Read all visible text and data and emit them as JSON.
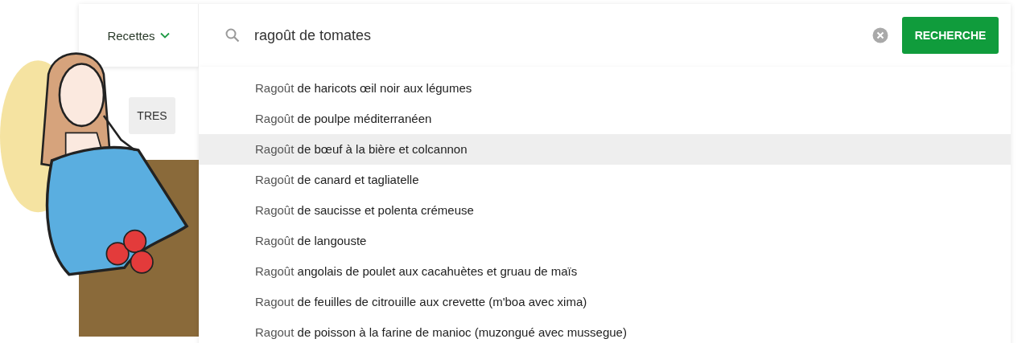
{
  "category_menu": {
    "label": "Recettes"
  },
  "search": {
    "value": "ragoût de tomates",
    "button": "RECHERCHE"
  },
  "filter_button": {
    "label": "TRES"
  },
  "suggestions": [
    {
      "match": "Ragoût",
      "rest": " de haricots œil noir aux légumes",
      "selected": false
    },
    {
      "match": "Ragoût",
      "rest": " de poulpe méditerranéen",
      "selected": false
    },
    {
      "match": "Ragoût",
      "rest": " de bœuf à la bière et colcannon",
      "selected": true
    },
    {
      "match": "Ragoût",
      "rest": " de canard et tagliatelle",
      "selected": false
    },
    {
      "match": "Ragoût",
      "rest": " de saucisse et polenta crémeuse",
      "selected": false
    },
    {
      "match": "Ragoût",
      "rest": " de langouste",
      "selected": false
    },
    {
      "match": "Ragoût",
      "rest": " angolais de poulet aux cacahuètes et gruau de maïs",
      "selected": false
    },
    {
      "match": "Ragout",
      "rest": " de feuilles de citrouille aux crevette (m'boa avec xima)",
      "selected": false
    },
    {
      "match": "Ragout",
      "rest": " de poisson à la farine de manioc (muzongué avec mussegue)",
      "selected": false
    }
  ]
}
